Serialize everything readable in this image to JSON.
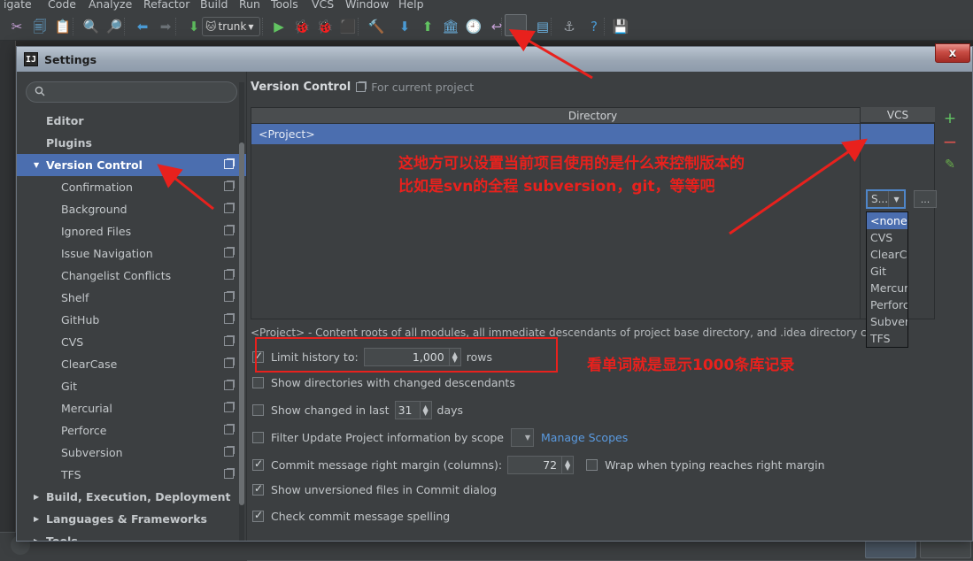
{
  "ide": {
    "menu": [
      "igate",
      "Code",
      "Analyze",
      "Refactor",
      "Build",
      "Run",
      "Tools",
      "VCS",
      "Window",
      "Help"
    ],
    "toolbar": {
      "branch_label": "trunk",
      "icons": [
        "cut-icon",
        "copy-icon",
        "paste-icon",
        "find-icon",
        "replace-icon",
        "back-icon",
        "forward-icon",
        "compile-icon",
        "run-icon",
        "debug-icon",
        "run-coverage-icon",
        "stop-icon",
        "build-icon",
        "vcs-update-icon",
        "vcs-commit-icon",
        "history-icon",
        "rollback-changes-icon",
        "undo-icon",
        "settings-icon",
        "project-structure-icon",
        "sdk-icon",
        "help-icon",
        "save-all-icon"
      ]
    }
  },
  "dialog": {
    "title": "Settings",
    "close_label": "x",
    "search": {
      "value": "",
      "placeholder": ""
    },
    "sidebar": {
      "items": [
        {
          "label": "Editor",
          "level": "top",
          "arrow": "",
          "copy": false,
          "selected": false
        },
        {
          "label": "Plugins",
          "level": "top",
          "arrow": "",
          "copy": false,
          "selected": false
        },
        {
          "label": "Version Control",
          "level": "top",
          "arrow": "▼",
          "copy": true,
          "selected": true
        },
        {
          "label": "Confirmation",
          "level": "child",
          "arrow": "",
          "copy": true,
          "selected": false
        },
        {
          "label": "Background",
          "level": "child",
          "arrow": "",
          "copy": true,
          "selected": false
        },
        {
          "label": "Ignored Files",
          "level": "child",
          "arrow": "",
          "copy": true,
          "selected": false
        },
        {
          "label": "Issue Navigation",
          "level": "child",
          "arrow": "",
          "copy": true,
          "selected": false
        },
        {
          "label": "Changelist Conflicts",
          "level": "child",
          "arrow": "",
          "copy": true,
          "selected": false
        },
        {
          "label": "Shelf",
          "level": "child",
          "arrow": "",
          "copy": true,
          "selected": false
        },
        {
          "label": "GitHub",
          "level": "child",
          "arrow": "",
          "copy": true,
          "selected": false
        },
        {
          "label": "CVS",
          "level": "child",
          "arrow": "",
          "copy": true,
          "selected": false
        },
        {
          "label": "ClearCase",
          "level": "child",
          "arrow": "",
          "copy": true,
          "selected": false
        },
        {
          "label": "Git",
          "level": "child",
          "arrow": "",
          "copy": true,
          "selected": false
        },
        {
          "label": "Mercurial",
          "level": "child",
          "arrow": "",
          "copy": true,
          "selected": false
        },
        {
          "label": "Perforce",
          "level": "child",
          "arrow": "",
          "copy": true,
          "selected": false
        },
        {
          "label": "Subversion",
          "level": "child",
          "arrow": "",
          "copy": true,
          "selected": false
        },
        {
          "label": "TFS",
          "level": "child",
          "arrow": "",
          "copy": true,
          "selected": false
        },
        {
          "label": "Build, Execution, Deployment",
          "level": "top",
          "arrow": "▶",
          "copy": false,
          "selected": false
        },
        {
          "label": "Languages & Frameworks",
          "level": "top",
          "arrow": "▶",
          "copy": false,
          "selected": false
        },
        {
          "label": "Tools",
          "level": "top",
          "arrow": "▶",
          "copy": false,
          "selected": false
        }
      ]
    },
    "main": {
      "page_title": "Version Control",
      "scope_label": "For current project",
      "table": {
        "col_directory": "Directory",
        "col_vcs": "VCS",
        "row_directory": "<Project>",
        "row_vcs_value": "S..."
      },
      "ellipsis_label": "...",
      "side_buttons": [
        {
          "name": "add-button",
          "glyph": "+"
        },
        {
          "name": "remove-button",
          "glyph": "−"
        },
        {
          "name": "edit-button",
          "glyph": "✎"
        }
      ],
      "vcs_dropdown": {
        "options": [
          "<none>",
          "CVS",
          "ClearCa",
          "Git",
          "Mercuri",
          "Perforc",
          "Subvers",
          "TFS"
        ],
        "selected_index": 0
      },
      "note": "<Project> - Content roots of all modules, all immediate descendants of project base directory, and .idea directory contents",
      "options": [
        {
          "name": "limit-history",
          "label": "Limit history to:",
          "checked": true,
          "value": "1,000",
          "suffix": "rows"
        },
        {
          "name": "show-dirs-changed-descendants",
          "label": "Show directories with changed descendants",
          "checked": false
        },
        {
          "name": "show-changed-in-last",
          "label": "Show changed in last",
          "checked": false,
          "value": "31",
          "suffix": "days"
        },
        {
          "name": "filter-update-by-scope",
          "label": "Filter Update Project information by scope",
          "checked": false,
          "link": "Manage Scopes"
        },
        {
          "name": "commit-right-margin",
          "label": "Commit message right margin (columns):",
          "checked": true,
          "value": "72",
          "extra_label": "Wrap when typing reaches right margin",
          "extra_checked": false
        },
        {
          "name": "show-unversioned-files",
          "label": "Show unversioned files in Commit dialog",
          "checked": true
        },
        {
          "name": "check-spelling",
          "label": "Check commit message spelling",
          "checked": true
        }
      ]
    }
  },
  "annotations": {
    "vcs_note_line1": "这地方可以设置当前项目使用的是什么来控制版本的",
    "vcs_note_line2": "比如是svn的全程 subversion，git，等等吧",
    "limit_note": "看单词就是显示1000条库记录",
    "color": "#e8211d"
  }
}
